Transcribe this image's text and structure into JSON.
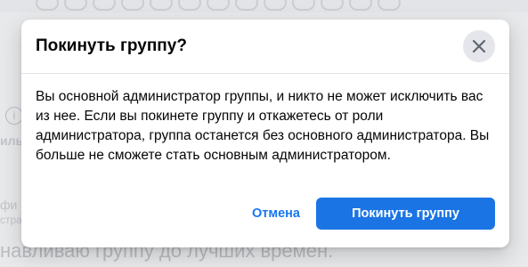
{
  "background": {
    "side_texts": [
      "ильн",
      "фи",
      "стра"
    ],
    "bottom_text": "навливаю группу до лучших времен.",
    "info_icon": "info-icon"
  },
  "dialog": {
    "title": "Покинуть группу?",
    "close_icon": "close-icon",
    "body": "Вы основной администратор группы, и никто не может исключить вас из нее. Если вы покинете группу и откажетесь от роли администратора, группа останется без основного администратора. Вы больше не сможете стать основным администратором.",
    "cancel_label": "Отмена",
    "confirm_label": "Покинуть группу"
  },
  "colors": {
    "primary": "#1b74e4",
    "link": "#1877f2",
    "close_bg": "#e4e6eb"
  }
}
